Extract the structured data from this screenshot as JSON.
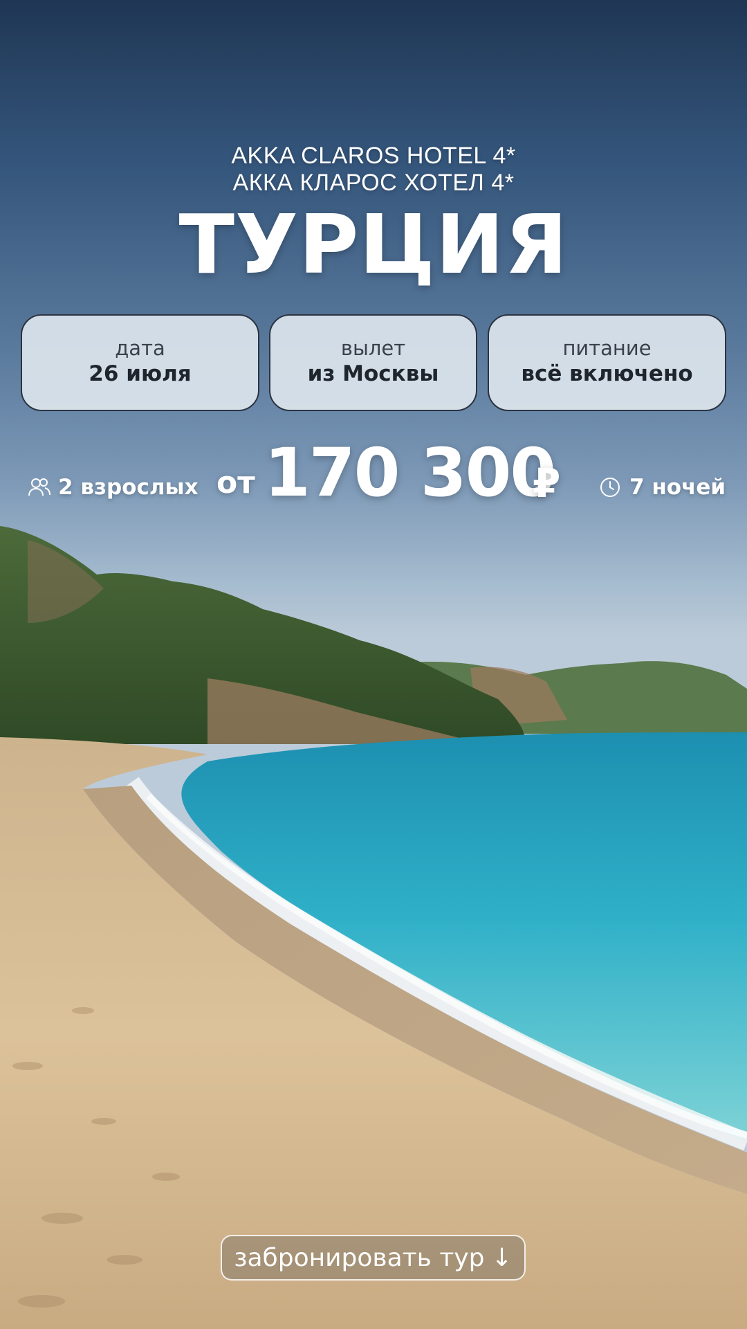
{
  "hotel": {
    "name_latin": "AKKA CLAROS HOTEL 4*",
    "name_cyrillic": "АККА КЛАРОС ХОТЕЛ 4*"
  },
  "country": "ТУРЦИЯ",
  "cards": [
    {
      "label": "дата",
      "value": "26 июля"
    },
    {
      "label": "вылет",
      "value": "из Москвы"
    },
    {
      "label": "питание",
      "value": "всё включено"
    }
  ],
  "travelers": {
    "text": "2 взрослых",
    "icon": "people-icon"
  },
  "price": {
    "prefix": "от",
    "amount": "170 300",
    "currency": "₽"
  },
  "duration": {
    "text": "7 ночей",
    "icon": "clock-icon"
  },
  "cta": {
    "label": "забронировать тур",
    "arrow": "↓"
  },
  "colors": {
    "sky_top": "#1f3654",
    "sea": "#2aa5bf",
    "sand": "#d9bf97",
    "card_bg": "#dce4ec",
    "text": "#ffffff"
  }
}
